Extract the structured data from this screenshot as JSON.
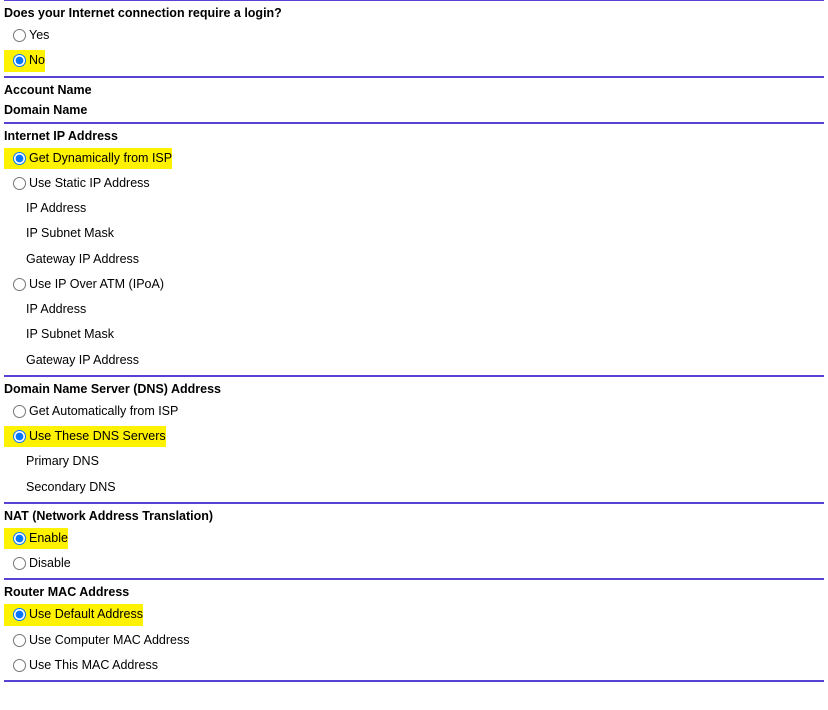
{
  "login": {
    "header": "Does your Internet connection require a login?",
    "yes": "Yes",
    "no": "No"
  },
  "account": {
    "accountName": "Account Name",
    "domainName": "Domain Name"
  },
  "ip": {
    "header": "Internet IP Address",
    "dynamic": "Get Dynamically from ISP",
    "static": "Use Static IP Address",
    "ipAddress": "IP Address",
    "subnetMask": "IP Subnet Mask",
    "gateway": "Gateway IP Address",
    "ipoa": "Use IP Over ATM (IPoA)"
  },
  "dns": {
    "header": "Domain Name Server (DNS) Address",
    "auto": "Get Automatically from ISP",
    "manual": "Use These DNS Servers",
    "primary": "Primary DNS",
    "secondary": "Secondary DNS"
  },
  "nat": {
    "header": "NAT (Network Address Translation)",
    "enable": "Enable",
    "disable": "Disable"
  },
  "mac": {
    "header": "Router MAC Address",
    "default": "Use Default Address",
    "computer": "Use Computer MAC Address",
    "this": "Use This MAC Address"
  }
}
